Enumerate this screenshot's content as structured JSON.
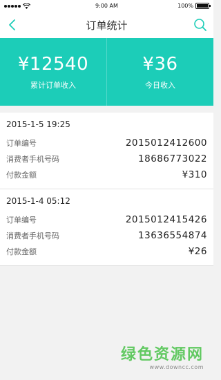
{
  "status_bar": {
    "time": "9:00 AM",
    "battery": "100%",
    "battery_level": 1.0
  },
  "nav": {
    "title": "订单统计",
    "back_icon": "chevron-left-icon",
    "search_icon": "search-icon"
  },
  "stats": [
    {
      "value": "¥12540",
      "label": "累计订单收入"
    },
    {
      "value": "¥36",
      "label": "今日收入"
    }
  ],
  "order_labels": {
    "order_no": "订单编号",
    "phone": "消费者手机号码",
    "amount": "付款金额"
  },
  "orders": [
    {
      "datetime": "2015-1-5 19:25",
      "order_no": "2015012412600",
      "phone": "18686773022",
      "amount": "¥310"
    },
    {
      "datetime": "2015-1-4 05:12",
      "order_no": "2015012415426",
      "phone": "13636554874",
      "amount": "¥26"
    }
  ],
  "watermark": {
    "title": "绿色资源网",
    "url": "www.downcc.com"
  },
  "colors": {
    "accent": "#1ccdb8",
    "background": "#f2f2f2"
  }
}
